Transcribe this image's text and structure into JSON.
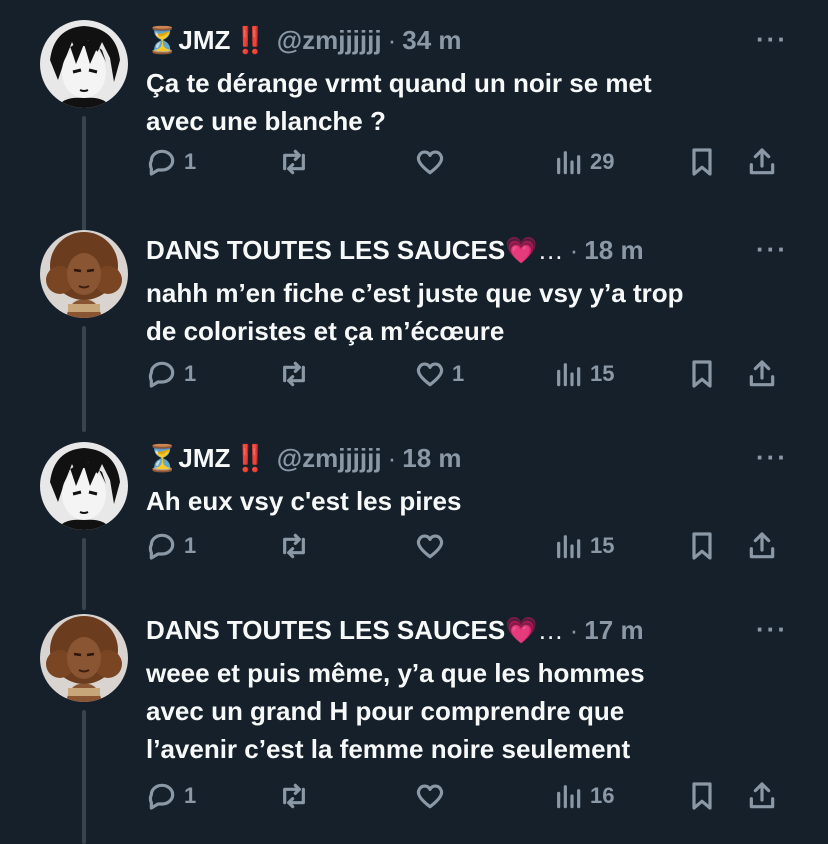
{
  "tweets": [
    {
      "name": "JMZ",
      "prefix_emoji": "⏳",
      "suffix_emoji": "‼️",
      "handle": "@zmjjjjjj",
      "time": "34 m",
      "text": "Ça te dérange vrmt quand un noir se met\navec une blanche ?",
      "replies": "1",
      "retweets": "",
      "likes": "",
      "views": "29",
      "avatar": "manga-boy-avatar"
    },
    {
      "name": "DANS TOUTES LES SAUCES",
      "prefix_emoji": "",
      "suffix_emoji": "💗…",
      "handle": "",
      "time": "18 m",
      "text": "nahh m’en fiche c’est juste que vsy y’a trop\nde coloristes et ça m’écœure",
      "replies": "1",
      "retweets": "",
      "likes": "1",
      "views": "15",
      "avatar": "curly-girl-avatar"
    },
    {
      "name": "JMZ",
      "prefix_emoji": "⏳",
      "suffix_emoji": "‼️",
      "handle": "@zmjjjjjj",
      "time": "18 m",
      "text": "Ah eux vsy c'est les pires",
      "replies": "1",
      "retweets": "",
      "likes": "",
      "views": "15",
      "avatar": "manga-boy-avatar"
    },
    {
      "name": "DANS TOUTES LES SAUCES",
      "prefix_emoji": "",
      "suffix_emoji": "💗…",
      "handle": "",
      "time": "17 m",
      "text": "weee et puis même, y’a que les hommes\navec un grand H pour comprendre que\nl’avenir c’est la femme noire seulement",
      "replies": "1",
      "retweets": "",
      "likes": "",
      "views": "16",
      "avatar": "curly-girl-avatar"
    }
  ],
  "more_label": "···",
  "time_separator": "·",
  "colors": {
    "background": "#15202b",
    "text": "#f7f9f9",
    "muted": "#8b98a5",
    "thread": "#38444d"
  }
}
